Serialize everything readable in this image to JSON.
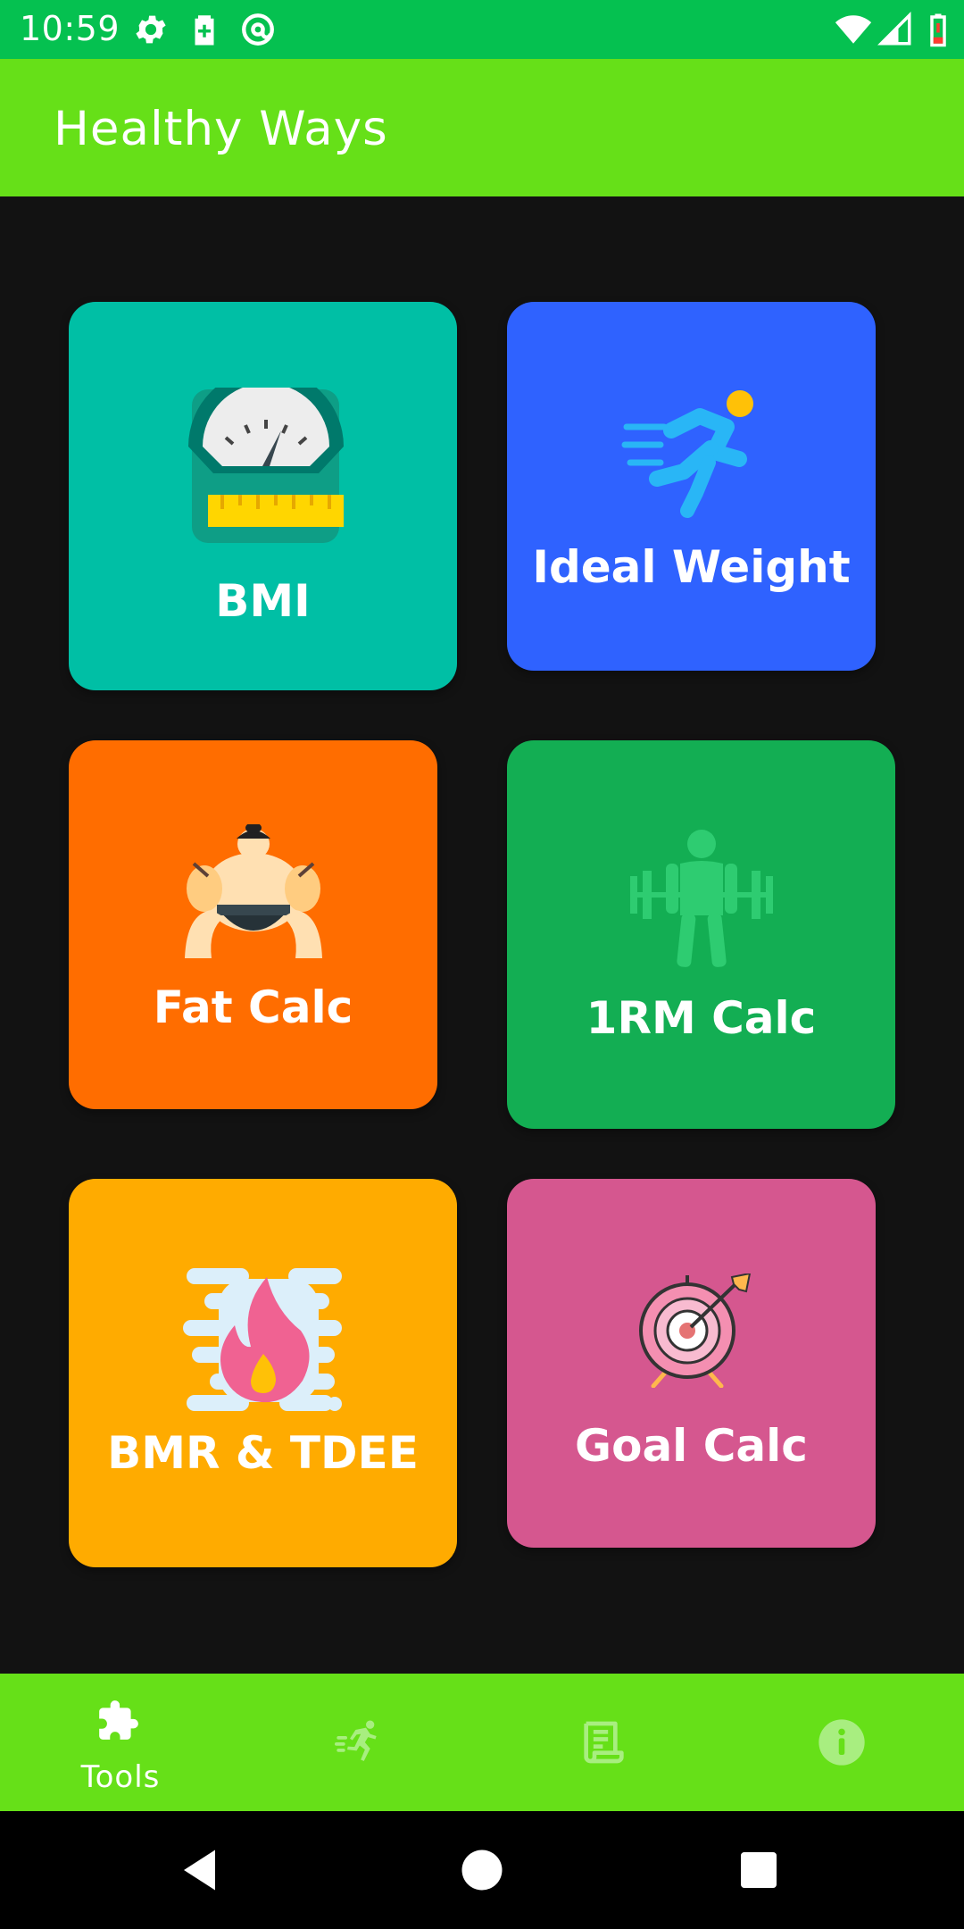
{
  "status_bar": {
    "time": "10:59",
    "left_icons": [
      "settings-icon",
      "battery-saver-icon",
      "at-sign-icon"
    ],
    "right_icons": [
      "wifi-icon",
      "cell-signal-icon",
      "battery-low-icon"
    ],
    "background": "#05C150"
  },
  "app_bar": {
    "title": "Healthy Ways",
    "background": "#66E018"
  },
  "tools": [
    {
      "label": "BMI",
      "icon": "weight-scale-icon",
      "color": "#00BFA5"
    },
    {
      "label": "Ideal Weight",
      "icon": "runner-icon",
      "color": "#2F62FF"
    },
    {
      "label": "Fat Calc",
      "icon": "sumo-wrestler-icon",
      "color": "#FF6D00"
    },
    {
      "label": "1RM Calc",
      "icon": "weightlifter-icon",
      "color": "#13AE53"
    },
    {
      "label": "BMR & TDEE",
      "icon": "fire-icon",
      "color": "#FFAB00"
    },
    {
      "label": "Goal Calc",
      "icon": "target-icon",
      "color": "#D5578F"
    }
  ],
  "bottom_nav": {
    "background": "#66E018",
    "items": [
      {
        "label": "Tools",
        "icon": "puzzle-icon",
        "selected": true
      },
      {
        "label": "",
        "icon": "running-man-icon",
        "selected": false
      },
      {
        "label": "",
        "icon": "document-icon",
        "selected": false
      },
      {
        "label": "",
        "icon": "info-icon",
        "selected": false
      }
    ]
  },
  "system_nav": [
    "back-button",
    "home-button",
    "recents-button"
  ]
}
